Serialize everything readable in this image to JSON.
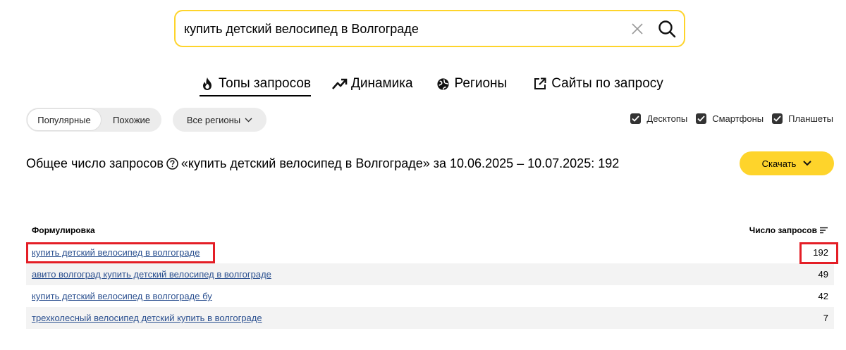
{
  "search": {
    "query": "купить детский велосипед в Волгограде"
  },
  "tabs": [
    {
      "label": "Топы запросов",
      "icon": "fire-icon",
      "active": true
    },
    {
      "label": "Динамика",
      "icon": "trend-icon",
      "active": false
    },
    {
      "label": "Регионы",
      "icon": "globe-icon",
      "active": false
    },
    {
      "label": "Сайты по запросу",
      "icon": "external-link-icon",
      "active": false
    }
  ],
  "filters": {
    "segment": {
      "popular": "Популярные",
      "similar": "Похожие",
      "selected": "popular"
    },
    "regions_label": "Все регионы",
    "devices": [
      {
        "label": "Десктопы",
        "checked": true
      },
      {
        "label": "Смартфоны",
        "checked": true
      },
      {
        "label": "Планшеты",
        "checked": true
      }
    ]
  },
  "summary": {
    "prefix": "Общее число запросов",
    "rest": "«купить детский велосипед в Волгограде» за 10.06.2025 – 10.07.2025: 192"
  },
  "download_label": "Скачать",
  "table": {
    "headers": {
      "phrase": "Формулировка",
      "count": "Число запросов"
    },
    "rows": [
      {
        "phrase": "купить детский велосипед в волгограде",
        "count": "192"
      },
      {
        "phrase": "авито волгоград купить детский велосипед в волгограде",
        "count": "49"
      },
      {
        "phrase": "купить детский велосипед в волгограде бу",
        "count": "42"
      },
      {
        "phrase": "трехколесный велосипед детский купить в волгограде",
        "count": "7"
      }
    ]
  },
  "colors": {
    "accent_yellow": "#fed42b",
    "link": "#2a4f8f",
    "highlight_red": "#e41e26",
    "row_shade": "#f3f3f3"
  }
}
